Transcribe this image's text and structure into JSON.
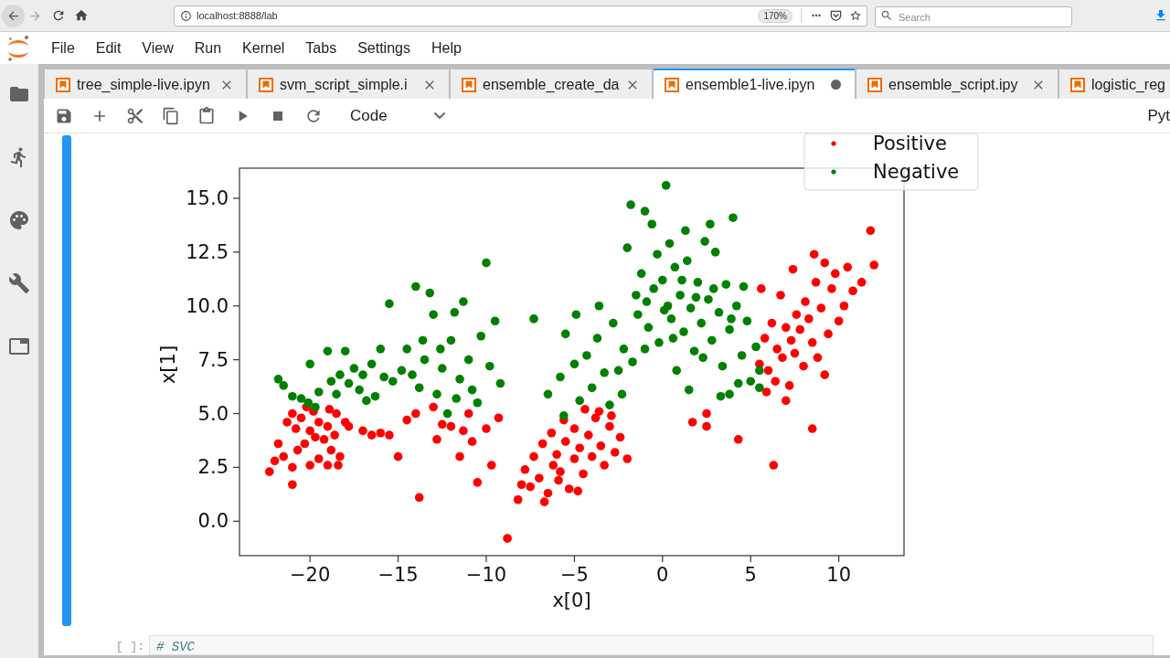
{
  "browser": {
    "url": "localhost:8888/lab",
    "zoom": "170%",
    "search": {
      "placeholder": "Search"
    }
  },
  "menu_bar": {
    "items": [
      "File",
      "Edit",
      "View",
      "Run",
      "Kernel",
      "Tabs",
      "Settings",
      "Help"
    ]
  },
  "tabs": [
    {
      "label": "tree_simple-live.ipyn",
      "selected": false,
      "unsaved": false
    },
    {
      "label": "svm_script_simple.i",
      "selected": false,
      "unsaved": false
    },
    {
      "label": "ensemble_create_da",
      "selected": false,
      "unsaved": false
    },
    {
      "label": "ensemble1-live.ipyn",
      "selected": true,
      "unsaved": true
    },
    {
      "label": "ensemble_script.ipy",
      "selected": false,
      "unsaved": false
    },
    {
      "label": "logistic_reg",
      "selected": false
    }
  ],
  "toolbar": {
    "cell_type": "Code",
    "kernel": "Pyt"
  },
  "notebook": {
    "cells": [
      {
        "selected": true,
        "output": {
          "chart_data": {
            "type": "scatter",
            "xlabel": "x[0]",
            "ylabel": "x[1]",
            "xlim": [
              -24,
              13.7
            ],
            "ylim": [
              -1.6,
              16.4
            ],
            "xticks": [
              {
                "value": -20,
                "label": "−20"
              },
              {
                "value": -15,
                "label": "−15"
              },
              {
                "value": -10,
                "label": "−10"
              },
              {
                "value": -5,
                "label": "−5"
              },
              0,
              5,
              10
            ],
            "yticks": [
              {
                "value": 0,
                "label": "0.0"
              },
              {
                "value": 2.5,
                "label": "2.5"
              },
              {
                "value": 5,
                "label": "5.0"
              },
              {
                "value": 7.5,
                "label": "7.5"
              },
              {
                "value": 10,
                "label": "10.0"
              },
              {
                "value": 12.5,
                "label": "12.5"
              },
              {
                "value": 15,
                "label": "15.0"
              }
            ],
            "legend": "upper right",
            "series": [
              {
                "name": "Positive",
                "color": "#ff0000",
                "x": [
                  -22.3,
                  -22,
                  -21.5,
                  -21,
                  -21,
                  -20.7,
                  -20.3,
                  -20,
                  -20.5,
                  -21,
                  -19.8,
                  -19.5,
                  -19,
                  -18.5,
                  -18,
                  -19.2,
                  -18.8,
                  -18.3,
                  -19.5,
                  -20,
                  -19,
                  -18.4,
                  -18.6,
                  -17.8,
                  -21.8,
                  -20.8,
                  -19.7,
                  -18.9,
                  -20.2,
                  -21.3,
                  -17,
                  -16.5,
                  -16,
                  -15.5,
                  -15,
                  -14.5,
                  -14,
                  -13.8,
                  -13,
                  -12.5,
                  -12,
                  -11.5,
                  -11.3,
                  -11,
                  -10.8,
                  -10.5,
                  -10,
                  -9.7,
                  -9.3,
                  -12.8,
                  -8.8,
                  -8.2,
                  -8,
                  -7.8,
                  -7.3,
                  -7,
                  -6.8,
                  -6.5,
                  -6.3,
                  -6,
                  -5.8,
                  -5.5,
                  -5.3,
                  -5,
                  -5,
                  -4.7,
                  -4.5,
                  -4.2,
                  -4,
                  -3.8,
                  -3.5,
                  -3.3,
                  -3,
                  -2.7,
                  -2.4,
                  -2,
                  -6.2,
                  -7.5,
                  -5.6,
                  -4.4,
                  -3.6,
                  -2.9,
                  -6.7,
                  -5.9,
                  -4.8,
                  1.7,
                  2.5,
                  2.5,
                  4.3,
                  5.5,
                  5.8,
                  6,
                  6.2,
                  6.4,
                  6.5,
                  6.7,
                  6.8,
                  7,
                  7.2,
                  7.3,
                  7.5,
                  7.6,
                  7.8,
                  8,
                  8.1,
                  8.3,
                  8.5,
                  8.7,
                  8.8,
                  9,
                  9.2,
                  9.4,
                  9.6,
                  9.8,
                  10,
                  10.3,
                  10.5,
                  10.8,
                  11.3,
                  12,
                  11.8,
                  8.5,
                  6.3,
                  9.2,
                  5.6,
                  5.9,
                  7,
                  7.4,
                  8.6
                ],
                "values": [
                  2.3,
                  2.8,
                  3,
                  2.5,
                  1.7,
                  3.3,
                  3.6,
                  4.2,
                  4.8,
                  5,
                  5.1,
                  4.6,
                  4.4,
                  5,
                  4.6,
                  3.8,
                  3.3,
                  3,
                  2.9,
                  2.6,
                  2.6,
                  2.6,
                  4,
                  4.4,
                  3.6,
                  4.3,
                  3.9,
                  5.2,
                  5.3,
                  4.6,
                  4.2,
                  4,
                  4.1,
                  4,
                  3,
                  4.7,
                  5,
                  1.1,
                  5.3,
                  4.5,
                  4.4,
                  3,
                  4.2,
                  5,
                  3.7,
                  1.8,
                  4.3,
                  2.6,
                  4.8,
                  3.8,
                  -0.8,
                  1,
                  1.7,
                  2.4,
                  3,
                  2,
                  3.6,
                  1.3,
                  4.1,
                  3.1,
                  2.3,
                  3.7,
                  1.5,
                  2.9,
                  4.3,
                  3.4,
                  2.2,
                  4,
                  3,
                  4.8,
                  3.5,
                  2.6,
                  4.4,
                  3.2,
                  3.9,
                  2.9,
                  2.6,
                  1.6,
                  4.7,
                  5.2,
                  5.1,
                  4.9,
                  0.9,
                  1.9,
                  1.4,
                  4.6,
                  4.4,
                  5,
                  3.8,
                  7.3,
                  8.5,
                  7,
                  9.2,
                  6.5,
                  8,
                  10.5,
                  7.6,
                  9,
                  6.3,
                  8.4,
                  7.8,
                  9.6,
                  8.9,
                  7.2,
                  10.2,
                  9.4,
                  8.3,
                  11.1,
                  7.6,
                  9.9,
                  12,
                  8.7,
                  10.8,
                  11.5,
                  9.3,
                  10,
                  11.8,
                  10.7,
                  11.1,
                  11.9,
                  13.5,
                  4.3,
                  2.6,
                  6.8,
                  10.8,
                  6,
                  5.6,
                  11.7,
                  12.4
                ]
              },
              {
                "name": "Negative",
                "color": "#008000",
                "x": [
                  -21.8,
                  -21.5,
                  -21,
                  -20.5,
                  -20.1,
                  -20,
                  -19.5,
                  -19,
                  -18.8,
                  -18.5,
                  -18.3,
                  -18,
                  -17.8,
                  -17.5,
                  -17.2,
                  -17,
                  -16.8,
                  -16.5,
                  -16,
                  -15.8,
                  -15.5,
                  -15.3,
                  -14.8,
                  -14.5,
                  -14.2,
                  -14,
                  -13.8,
                  -13.5,
                  -13.2,
                  -13,
                  -12.8,
                  -12.5,
                  -12.2,
                  -12,
                  -11.8,
                  -11.5,
                  -11.3,
                  -11,
                  -10.8,
                  -10.5,
                  -10.3,
                  -10,
                  -9.8,
                  -9.5,
                  -9.2,
                  -13.6,
                  -12.6,
                  -11.7,
                  -16.3,
                  -19.7,
                  -7.3,
                  -6.5,
                  -5.8,
                  -5.5,
                  -5,
                  -4.7,
                  -4.3,
                  -4,
                  -3.7,
                  -3.3,
                  -3,
                  -2.8,
                  -2.5,
                  -2.2,
                  -3.6,
                  -4.9,
                  -5.6,
                  -2,
                  -1.8,
                  -1,
                  0.2,
                  -0.6,
                  -1.5,
                  -1.2,
                  -0.8,
                  -0.5,
                  -0.2,
                  0,
                  0.3,
                  0.5,
                  0.7,
                  1,
                  1.2,
                  1.4,
                  1.6,
                  1.8,
                  2,
                  2.2,
                  2.4,
                  2.6,
                  2.8,
                  3,
                  3.2,
                  3.4,
                  3.6,
                  3.8,
                  4,
                  4.2,
                  4.5,
                  4.8,
                  5,
                  5.3,
                  5.5,
                  -1.7,
                  -1,
                  -0.3,
                  0.8,
                  1.5,
                  2.7,
                  3.3,
                  4.3,
                  -1.4,
                  0.1,
                  1.1,
                  2.9,
                  3.9,
                  0.6,
                  1.9,
                  2.3,
                  -0.9,
                  4.6,
                  0.4,
                  1.3,
                  -2.3,
                  3.8,
                  5.5
                ],
                "values": [
                  6.6,
                  6.3,
                  5.8,
                  5.7,
                  5.5,
                  7.3,
                  6,
                  7.9,
                  6.5,
                  5.9,
                  6.8,
                  7.9,
                  6.4,
                  7.1,
                  6.1,
                  6.8,
                  5.6,
                  7.3,
                  8,
                  6.7,
                  10.1,
                  6.5,
                  7,
                  8,
                  6.8,
                  10.9,
                  6.2,
                  7.5,
                  10.6,
                  9.6,
                  5.9,
                  7.1,
                  5,
                  8.4,
                  9.7,
                  6.6,
                  10.2,
                  7.5,
                  6.1,
                  5.5,
                  8.6,
                  12,
                  7.2,
                  9.3,
                  6.4,
                  8.4,
                  8,
                  5.7,
                  5.8,
                  5.3,
                  9.4,
                  5.9,
                  6.7,
                  8.7,
                  7.3,
                  5.6,
                  7.7,
                  6.2,
                  8.5,
                  6.9,
                  5.4,
                  9.2,
                  7,
                  8,
                  10,
                  9.6,
                  4.9,
                  12.7,
                  14.7,
                  14.4,
                  15.6,
                  13.8,
                  10.5,
                  11.5,
                  9,
                  10.8,
                  8.3,
                  11.2,
                  10,
                  9.4,
                  11.8,
                  10.5,
                  8.8,
                  12.1,
                  9.9,
                  7.9,
                  11.1,
                  9.2,
                  13,
                  10.3,
                  8.4,
                  12.5,
                  9.7,
                  7.2,
                  11,
                  8.9,
                  14.1,
                  10,
                  7.7,
                  9.3,
                  6.5,
                  8.1,
                  6.2,
                  7.4,
                  8,
                  12.4,
                  7,
                  6.1,
                  13.8,
                  5.8,
                  6.4,
                  9.6,
                  9.8,
                  11.2,
                  10.8,
                  9.4,
                  8.5,
                  10.4,
                  7.6,
                  10.2,
                  10.9,
                  12.9,
                  13.5,
                  5.9,
                  5.9,
                  7
                ]
              }
            ]
          }
        }
      },
      {
        "selected": false,
        "prompt": "[ ]:",
        "source": "# SVC"
      }
    ]
  }
}
